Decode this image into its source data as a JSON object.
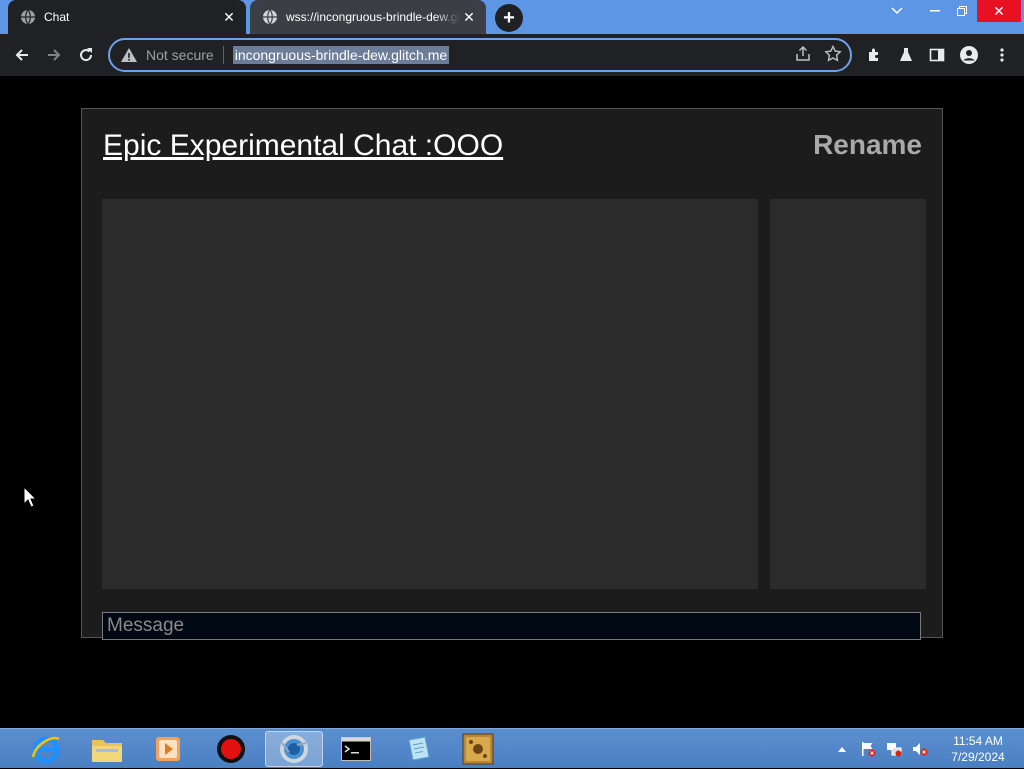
{
  "browser": {
    "tabs": [
      {
        "title": "Chat",
        "active": true
      },
      {
        "title": "wss://incongruous-brindle-dew.glitch.me",
        "active": false
      }
    ],
    "security_label": "Not secure",
    "url": "incongruous-brindle-dew.glitch.me"
  },
  "page": {
    "title": "Epic Experimental Chat :OOO",
    "rename_label": "Rename",
    "message_placeholder": "Message",
    "message_value": ""
  },
  "taskbar": {
    "apps": [
      "internet-explorer",
      "file-explorer",
      "media-player",
      "record-app",
      "chrome",
      "command-prompt",
      "notepad",
      "dosbox"
    ],
    "time": "11:54 AM",
    "date": "7/29/2024"
  },
  "colors": {
    "tabbar": "#5e96e6",
    "chrome_dark": "#202124",
    "panel": "#1c1c1c",
    "pane": "#2b2b2b",
    "rename": "#a9a9a9"
  }
}
